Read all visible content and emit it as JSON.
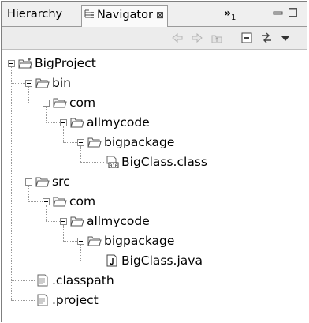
{
  "tabs": [
    {
      "label": "Hierarchy",
      "active": false
    },
    {
      "label": "Navigator",
      "active": true,
      "close_symbol": "⊠"
    }
  ],
  "tab_overflow": {
    "symbol": "»",
    "count": "1"
  },
  "window_controls": {
    "minimize": "▭",
    "maximize": "□"
  },
  "toolbar": {
    "buttons": [
      "back-icon",
      "forward-icon",
      "up-icon",
      "collapse-all-icon",
      "link-with-editor-icon",
      "view-menu-icon"
    ]
  },
  "tree": [
    {
      "label": "BigProject",
      "icon": "project-folder-icon",
      "depth": 0,
      "expanded": true
    },
    {
      "label": "bin",
      "icon": "folder-icon",
      "depth": 1,
      "expanded": true
    },
    {
      "label": "com",
      "icon": "folder-icon",
      "depth": 2,
      "expanded": true
    },
    {
      "label": "allmycode",
      "icon": "folder-icon",
      "depth": 3,
      "expanded": true
    },
    {
      "label": "bigpackage",
      "icon": "folder-icon",
      "depth": 4,
      "expanded": true
    },
    {
      "label": "BigClass.class",
      "icon": "class-file-icon",
      "depth": 5,
      "expanded": null
    },
    {
      "label": "src",
      "icon": "folder-icon",
      "depth": 1,
      "expanded": true
    },
    {
      "label": "com",
      "icon": "folder-icon",
      "depth": 2,
      "expanded": true
    },
    {
      "label": "allmycode",
      "icon": "folder-icon",
      "depth": 3,
      "expanded": true
    },
    {
      "label": "bigpackage",
      "icon": "folder-icon",
      "depth": 4,
      "expanded": true
    },
    {
      "label": "BigClass.java",
      "icon": "java-file-icon",
      "depth": 5,
      "expanded": null
    },
    {
      "label": ".classpath",
      "icon": "text-file-icon",
      "depth": 1,
      "expanded": null
    },
    {
      "label": ".project",
      "icon": "text-file-icon",
      "depth": 1,
      "expanded": null
    }
  ]
}
